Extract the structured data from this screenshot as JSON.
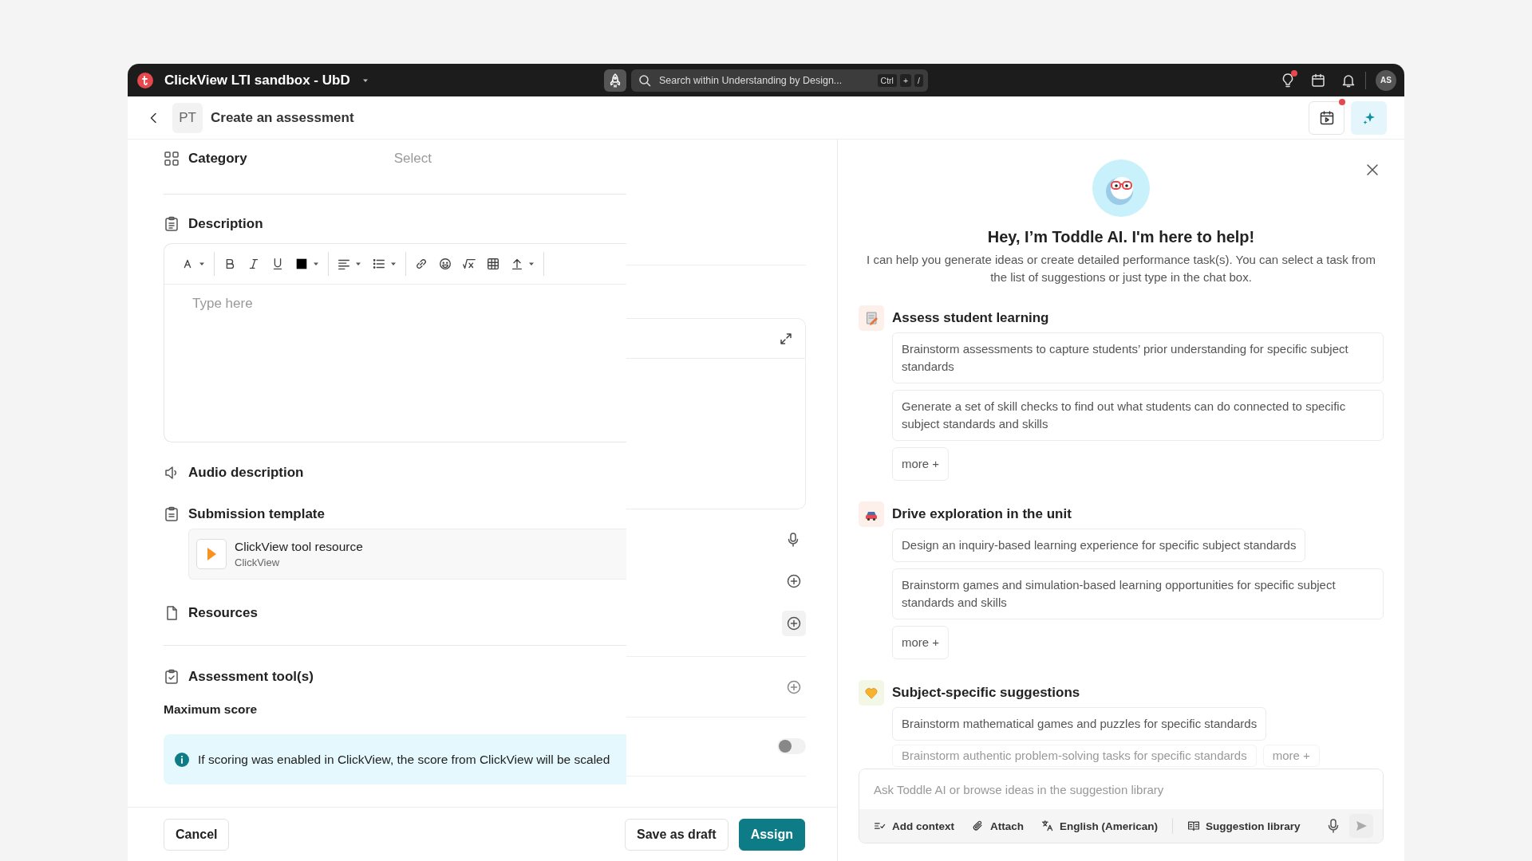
{
  "topbar": {
    "workspace": "ClickView LTI sandbox - UbD",
    "search": {
      "placeholder": "Search within Understanding by Design...",
      "shortcut": [
        "Ctrl",
        "+",
        "/"
      ]
    },
    "tips_dot": true,
    "avatar": "AS"
  },
  "header": {
    "badge": "PT",
    "title": "Create an assessment",
    "planner_dot": true,
    "assistant_open": true
  },
  "form": {
    "sections": [
      {
        "kind": "select",
        "label": "Category",
        "placeholder": "Select"
      },
      {
        "kind": "editor",
        "label": "Description",
        "placeholder": "Type here"
      },
      {
        "kind": "plain",
        "label": "Audio description"
      },
      {
        "kind": "resource",
        "label": "Submission template",
        "resource": {
          "title": "ClickView tool resource",
          "source": "ClickView"
        }
      },
      {
        "kind": "plain",
        "label": "Resources"
      },
      {
        "kind": "score",
        "label": "Assessment tool(s)",
        "sublabel": "Maximum score",
        "info": "If scoring was enabled in ClickView, the score from ClickView will be scaled"
      }
    ],
    "scoring_toggle": {
      "on": false
    }
  },
  "footer": {
    "cancel": "Cancel",
    "save": "Save as draft",
    "assign": "Assign"
  },
  "assistant": {
    "title": "Hey, I’m Toddle AI. I'm here to help!",
    "intro": "I can help you generate ideas or create detailed performance task(s). You can select a task from the list of suggestions or just type in the chat box.",
    "groups": [
      {
        "kind": "assess",
        "title": "Assess student learning",
        "suggestions": [
          "Brainstorm assessments to capture students’ prior understanding for specific subject standards",
          "Generate a set of skill checks to find out what students can do connected to specific subject standards and skills"
        ],
        "more": "more +"
      },
      {
        "kind": "explore",
        "title": "Drive exploration in the unit",
        "suggestions": [
          "Design an inquiry-based learning experience for specific subject standards",
          "Brainstorm games and simulation-based learning opportunities for specific subject standards and skills"
        ],
        "more": "more +"
      },
      {
        "kind": "subject",
        "title": "Subject-specific suggestions",
        "suggestions": [
          "Brainstorm mathematical games and puzzles for specific standards"
        ],
        "faded": {
          "suggestion": "Brainstorm authentic problem-solving tasks for specific standards",
          "more": "more +"
        }
      }
    ],
    "chat": {
      "placeholder": "Ask Toddle AI or browse ideas in the suggestion library",
      "actions": [
        "Add context",
        "Attach",
        "English (American)",
        "Suggestion library"
      ]
    }
  }
}
